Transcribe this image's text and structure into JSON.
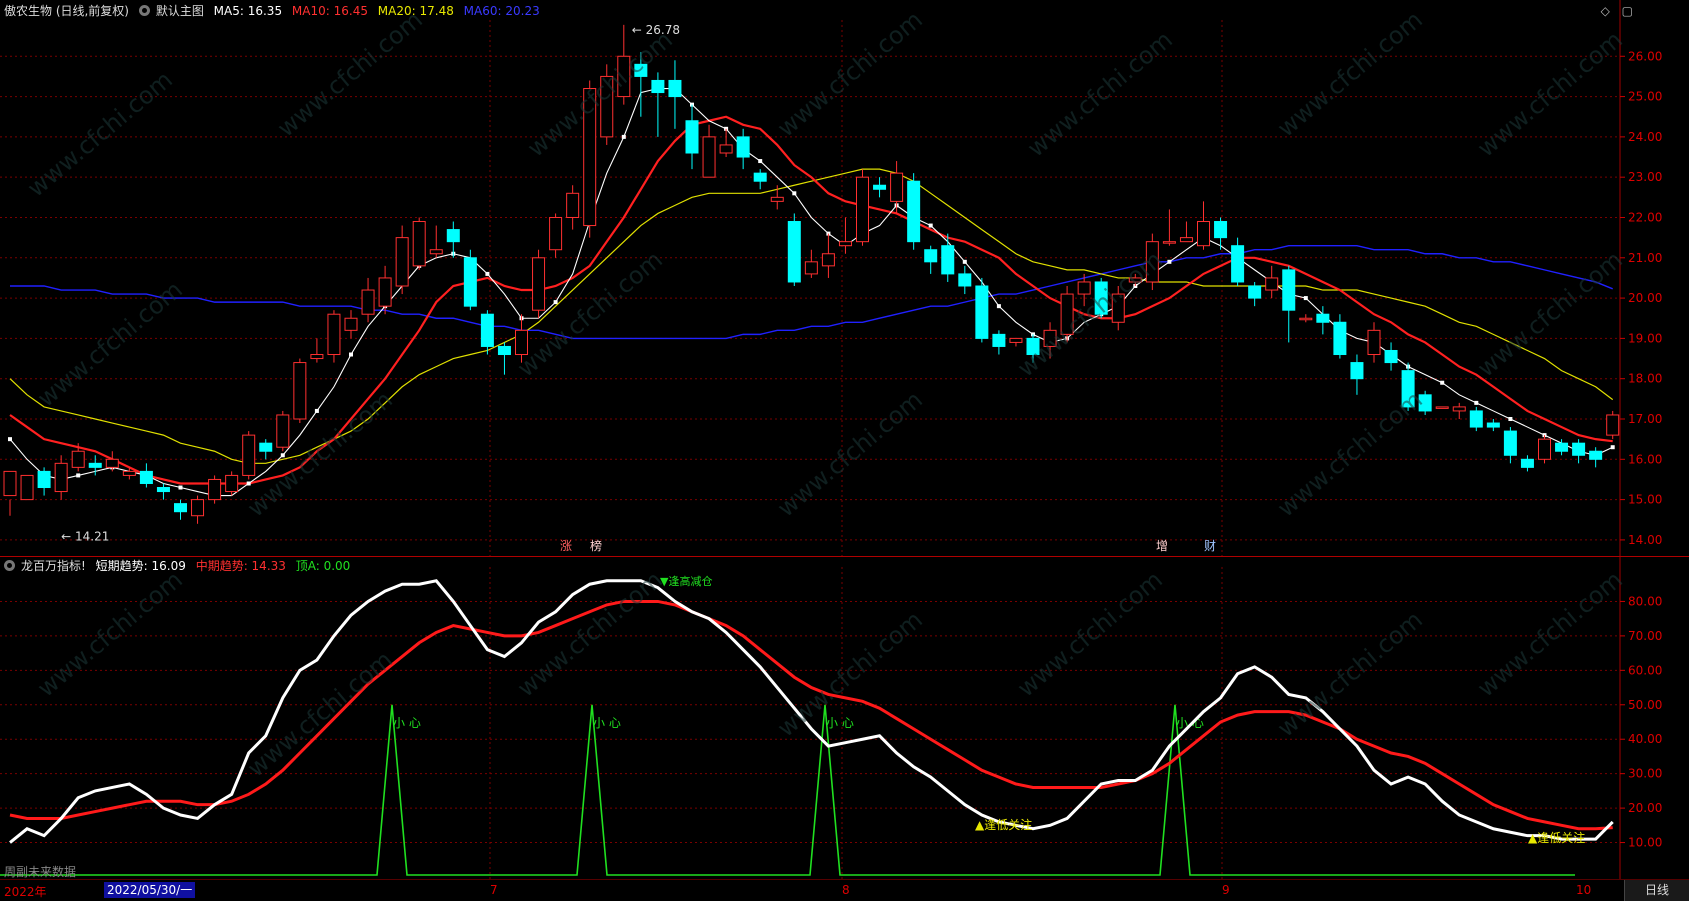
{
  "main_header": {
    "stock": "傲农生物 (日线,前复权)",
    "template": "默认主图",
    "ma5": "MA5: 16.35",
    "ma10": "MA10: 16.45",
    "ma20": "MA20: 17.48",
    "ma60": "MA60: 20.23"
  },
  "indicator_header": {
    "name": "龙百万指标!",
    "short": "短期趋势: 16.09",
    "mid": "中期趋势: 14.33",
    "top": "顶A: 0.00"
  },
  "annotations": {
    "high": "26.78",
    "low": "14.21",
    "tags": [
      "涨",
      "榜",
      "增",
      "财"
    ],
    "caution": "小 心",
    "follow": "逢低关注",
    "wave": "▼逢高减仓",
    "future_data": "周副未来数据"
  },
  "icons": [
    "gear-icon",
    "diamond-icon",
    "window-icon"
  ],
  "bottom_axis": {
    "year": "2022年",
    "date": "2022/05/30/一",
    "months": [
      "7",
      "8",
      "9",
      "10"
    ],
    "period_button": "日线"
  },
  "watermark": "www.cfchi.com",
  "colors": {
    "up": "#ff3030",
    "down": "#00ffff",
    "ma5": "#ffffff",
    "ma10": "#ff2020",
    "ma20": "#e0e000",
    "ma60": "#2020ff",
    "signal": "#20e020",
    "grid": "#7a0000"
  },
  "chart_data": [
    {
      "type": "candlestick",
      "y_ticks": [
        "26.00",
        "25.00",
        "24.00",
        "23.00",
        "22.00",
        "21.00",
        "20.00",
        "19.00",
        "18.00",
        "17.00",
        "16.00",
        "15.00",
        "14.00"
      ],
      "ylim": [
        13.7,
        26.9
      ],
      "candles": [
        [
          15.1,
          15.7,
          15.0,
          14.6
        ],
        [
          15.0,
          15.6,
          15.1,
          15.5
        ],
        [
          15.7,
          15.3,
          15.8,
          15.1
        ],
        [
          15.2,
          15.9,
          15.0,
          16.1
        ],
        [
          15.8,
          16.2,
          15.7,
          16.4
        ],
        [
          15.9,
          15.8,
          16.1,
          15.6
        ],
        [
          15.8,
          16.0,
          15.7,
          16.2
        ],
        [
          15.6,
          15.7,
          15.8,
          15.5
        ],
        [
          15.7,
          15.4,
          15.9,
          15.3
        ],
        [
          15.3,
          15.2,
          15.4,
          15.0
        ],
        [
          14.9,
          14.7,
          15.0,
          14.5
        ],
        [
          14.6,
          15.0,
          14.4,
          15.1
        ],
        [
          15.0,
          15.5,
          14.9,
          15.6
        ],
        [
          15.2,
          15.6,
          15.1,
          15.7
        ],
        [
          15.6,
          16.6,
          15.5,
          16.7
        ],
        [
          16.4,
          16.2,
          16.5,
          16.0
        ],
        [
          16.3,
          17.1,
          16.2,
          17.2
        ],
        [
          17.0,
          18.4,
          16.9,
          18.5
        ],
        [
          18.5,
          18.6,
          18.4,
          19.0
        ],
        [
          18.6,
          19.6,
          18.4,
          19.7
        ],
        [
          19.2,
          19.5,
          19.0,
          19.7
        ],
        [
          19.6,
          20.2,
          19.4,
          20.5
        ],
        [
          19.8,
          20.5,
          19.6,
          20.8
        ],
        [
          20.3,
          21.5,
          20.1,
          21.8
        ],
        [
          20.8,
          21.9,
          20.7,
          22.0
        ],
        [
          21.1,
          21.2,
          21.0,
          21.8
        ],
        [
          21.7,
          21.4,
          21.9,
          21.0
        ],
        [
          21.0,
          19.8,
          21.2,
          19.7
        ],
        [
          19.6,
          18.8,
          19.7,
          18.6
        ],
        [
          18.8,
          18.6,
          18.9,
          18.1
        ],
        [
          18.6,
          19.2,
          18.4,
          19.6
        ],
        [
          19.7,
          21.0,
          19.5,
          21.2
        ],
        [
          21.2,
          22.0,
          21.0,
          22.1
        ],
        [
          22.0,
          22.6,
          21.7,
          22.8
        ],
        [
          21.8,
          25.2,
          21.5,
          25.4
        ],
        [
          24.0,
          25.5,
          23.8,
          25.8
        ],
        [
          25.0,
          26.0,
          24.8,
          26.78
        ],
        [
          25.8,
          25.5,
          26.1,
          24.5
        ],
        [
          25.4,
          25.1,
          25.6,
          24.0
        ],
        [
          25.4,
          25.0,
          25.9,
          24.2
        ],
        [
          24.4,
          23.6,
          24.8,
          23.2
        ],
        [
          23.0,
          24.0,
          23.0,
          24.3
        ],
        [
          23.6,
          23.8,
          23.5,
          24.2
        ],
        [
          24.0,
          23.5,
          24.2,
          23.2
        ],
        [
          23.1,
          22.9,
          23.2,
          22.7
        ],
        [
          22.4,
          22.5,
          22.2,
          22.8
        ],
        [
          21.9,
          20.4,
          22.1,
          20.3
        ],
        [
          20.6,
          20.9,
          20.5,
          21.2
        ],
        [
          20.8,
          21.1,
          20.5,
          21.6
        ],
        [
          21.3,
          21.4,
          21.1,
          22.0
        ],
        [
          21.4,
          23.0,
          21.3,
          23.2
        ],
        [
          22.8,
          22.7,
          23.0,
          22.5
        ],
        [
          22.4,
          23.1,
          22.1,
          23.4
        ],
        [
          22.9,
          21.4,
          23.1,
          21.2
        ],
        [
          21.2,
          20.9,
          21.3,
          20.6
        ],
        [
          21.3,
          20.6,
          21.6,
          20.4
        ],
        [
          20.6,
          20.3,
          20.8,
          20.1
        ],
        [
          20.3,
          19.0,
          20.5,
          18.9
        ],
        [
          19.1,
          18.8,
          19.2,
          18.6
        ],
        [
          18.9,
          19.0,
          18.9,
          18.8
        ],
        [
          19.0,
          18.6,
          19.1,
          18.4
        ],
        [
          18.8,
          19.2,
          18.5,
          19.4
        ],
        [
          19.1,
          20.1,
          18.9,
          20.3
        ],
        [
          20.1,
          20.4,
          19.8,
          20.6
        ],
        [
          20.4,
          19.6,
          20.5,
          19.5
        ],
        [
          19.4,
          20.1,
          19.2,
          20.3
        ],
        [
          20.4,
          20.5,
          20.3,
          20.6
        ],
        [
          20.4,
          21.4,
          20.2,
          21.6
        ],
        [
          21.4,
          21.4,
          21.3,
          22.2
        ],
        [
          21.4,
          21.5,
          21.4,
          21.9
        ],
        [
          21.3,
          21.9,
          21.2,
          22.4
        ],
        [
          21.9,
          21.5,
          22.0,
          21.2
        ],
        [
          21.3,
          20.4,
          21.5,
          20.3
        ],
        [
          20.3,
          20.0,
          20.4,
          19.8
        ],
        [
          20.2,
          20.5,
          20.0,
          20.8
        ],
        [
          20.7,
          19.7,
          20.8,
          18.9
        ],
        [
          19.5,
          19.5,
          19.6,
          19.4
        ],
        [
          19.6,
          19.4,
          19.8,
          19.1
        ],
        [
          19.4,
          18.6,
          19.6,
          18.5
        ],
        [
          18.4,
          18.0,
          18.6,
          17.6
        ],
        [
          18.6,
          19.2,
          18.4,
          19.4
        ],
        [
          18.7,
          18.4,
          18.9,
          18.2
        ],
        [
          18.2,
          17.3,
          18.4,
          17.2
        ],
        [
          17.6,
          17.2,
          17.7,
          17.1
        ],
        [
          17.3,
          17.3,
          17.3,
          17.3
        ],
        [
          17.2,
          17.3,
          17.0,
          17.4
        ],
        [
          17.2,
          16.8,
          17.3,
          16.7
        ],
        [
          16.9,
          16.8,
          17.0,
          16.7
        ],
        [
          16.7,
          16.1,
          16.8,
          15.9
        ],
        [
          16.0,
          15.8,
          16.1,
          15.7
        ],
        [
          16.0,
          16.5,
          15.9,
          16.6
        ],
        [
          16.4,
          16.2,
          16.5,
          16.1
        ],
        [
          16.4,
          16.1,
          16.5,
          15.9
        ],
        [
          16.2,
          16.0,
          16.3,
          15.8
        ],
        [
          16.6,
          17.1,
          16.5,
          17.2
        ]
      ],
      "ma5": [
        16.5,
        16.0,
        15.6,
        15.5,
        15.6,
        15.7,
        15.8,
        15.7,
        15.6,
        15.4,
        15.3,
        15.2,
        15.1,
        15.1,
        15.4,
        15.7,
        16.1,
        16.6,
        17.2,
        17.8,
        18.6,
        19.3,
        19.8,
        20.3,
        20.8,
        21.0,
        21.1,
        21.0,
        20.6,
        20.1,
        19.5,
        19.5,
        19.9,
        20.6,
        21.9,
        23.1,
        24.0,
        25.1,
        25.2,
        25.2,
        24.8,
        24.4,
        24.2,
        23.7,
        23.4,
        23.0,
        22.6,
        22.0,
        21.6,
        21.3,
        21.6,
        21.8,
        22.3,
        22.0,
        21.8,
        21.4,
        20.9,
        20.4,
        19.8,
        19.4,
        19.1,
        18.9,
        19.0,
        19.4,
        19.6,
        19.8,
        20.3,
        20.6,
        20.9,
        21.2,
        21.5,
        21.3,
        21.0,
        20.7,
        20.4,
        20.1,
        20.0,
        19.6,
        19.2,
        19.0,
        18.9,
        18.6,
        18.3,
        18.1,
        17.9,
        17.6,
        17.4,
        17.2,
        17.0,
        16.8,
        16.6,
        16.4,
        16.2,
        16.1,
        16.3
      ],
      "ma10": [
        17.1,
        16.8,
        16.5,
        16.4,
        16.3,
        16.2,
        16.0,
        15.8,
        15.6,
        15.5,
        15.4,
        15.4,
        15.4,
        15.4,
        15.4,
        15.5,
        15.6,
        15.8,
        16.2,
        16.5,
        17.0,
        17.5,
        18.0,
        18.6,
        19.2,
        19.9,
        20.3,
        20.4,
        20.5,
        20.3,
        20.2,
        20.2,
        20.3,
        20.5,
        20.8,
        21.4,
        22.0,
        22.7,
        23.4,
        23.9,
        24.3,
        24.4,
        24.5,
        24.3,
        24.2,
        23.8,
        23.3,
        23.0,
        22.6,
        22.4,
        22.3,
        22.2,
        22.1,
        21.9,
        21.7,
        21.5,
        21.4,
        21.2,
        21.0,
        20.6,
        20.3,
        20.0,
        19.8,
        19.6,
        19.5,
        19.5,
        19.6,
        19.8,
        20.0,
        20.3,
        20.6,
        20.8,
        21.0,
        21.0,
        20.9,
        20.8,
        20.6,
        20.4,
        20.2,
        19.9,
        19.6,
        19.4,
        19.1,
        18.9,
        18.6,
        18.3,
        18.1,
        17.8,
        17.5,
        17.2,
        17.0,
        16.8,
        16.6,
        16.5,
        16.45
      ],
      "ma20": [
        18.0,
        17.6,
        17.3,
        17.2,
        17.1,
        17.0,
        16.9,
        16.8,
        16.7,
        16.6,
        16.4,
        16.3,
        16.2,
        16.0,
        15.9,
        15.9,
        16.0,
        16.1,
        16.3,
        16.5,
        16.7,
        17.0,
        17.4,
        17.8,
        18.1,
        18.3,
        18.5,
        18.6,
        18.7,
        18.9,
        19.1,
        19.4,
        19.8,
        20.2,
        20.6,
        21.0,
        21.4,
        21.8,
        22.1,
        22.3,
        22.5,
        22.6,
        22.6,
        22.6,
        22.6,
        22.7,
        22.8,
        22.9,
        23.0,
        23.1,
        23.2,
        23.2,
        23.1,
        22.9,
        22.6,
        22.3,
        22.0,
        21.7,
        21.4,
        21.1,
        20.9,
        20.8,
        20.7,
        20.7,
        20.6,
        20.5,
        20.5,
        20.4,
        20.4,
        20.4,
        20.3,
        20.3,
        20.3,
        20.3,
        20.3,
        20.3,
        20.3,
        20.2,
        20.2,
        20.2,
        20.1,
        20.0,
        19.9,
        19.8,
        19.6,
        19.4,
        19.3,
        19.1,
        18.9,
        18.7,
        18.5,
        18.2,
        18.0,
        17.8,
        17.48
      ],
      "ma60": [
        20.3,
        20.3,
        20.3,
        20.2,
        20.2,
        20.2,
        20.1,
        20.1,
        20.1,
        20.0,
        20.0,
        20.0,
        19.9,
        19.9,
        19.9,
        19.9,
        19.9,
        19.8,
        19.8,
        19.8,
        19.8,
        19.7,
        19.7,
        19.6,
        19.6,
        19.5,
        19.5,
        19.4,
        19.3,
        19.3,
        19.2,
        19.2,
        19.1,
        19.0,
        19.0,
        19.0,
        19.0,
        19.0,
        19.0,
        19.0,
        19.0,
        19.0,
        19.0,
        19.1,
        19.1,
        19.2,
        19.2,
        19.3,
        19.3,
        19.4,
        19.4,
        19.5,
        19.6,
        19.7,
        19.8,
        19.8,
        19.9,
        20.0,
        20.1,
        20.1,
        20.2,
        20.3,
        20.4,
        20.5,
        20.6,
        20.7,
        20.8,
        20.9,
        20.9,
        21.0,
        21.0,
        21.1,
        21.1,
        21.2,
        21.2,
        21.3,
        21.3,
        21.3,
        21.3,
        21.3,
        21.2,
        21.2,
        21.2,
        21.1,
        21.1,
        21.0,
        21.0,
        20.9,
        20.9,
        20.8,
        20.7,
        20.6,
        20.5,
        20.4,
        20.23
      ]
    },
    {
      "type": "line",
      "y_ticks": [
        "80.00",
        "70.00",
        "60.00",
        "50.00",
        "40.00",
        "30.00",
        "20.00",
        "10.00"
      ],
      "ylim": [
        0,
        90
      ],
      "short_trend": [
        10,
        14,
        12,
        17,
        23,
        25,
        26,
        27,
        24,
        20,
        18,
        17,
        21,
        24,
        36,
        41,
        52,
        60,
        63,
        70,
        76,
        80,
        83,
        85,
        85,
        86,
        80,
        73,
        66,
        64,
        68,
        74,
        77,
        82,
        85,
        86,
        86,
        86,
        84,
        80,
        77,
        75,
        71,
        66,
        61,
        55,
        49,
        43,
        38,
        39,
        40,
        41,
        36,
        32,
        29,
        25,
        21,
        18,
        16,
        15,
        14,
        15,
        17,
        22,
        27,
        28,
        28,
        31,
        38,
        43,
        48,
        52,
        59,
        61,
        58,
        53,
        52,
        48,
        43,
        38,
        31,
        27,
        29,
        27,
        22,
        18,
        16,
        14,
        13,
        12,
        12,
        11,
        11,
        11,
        16
      ],
      "mid_trend": [
        18,
        17,
        17,
        17,
        18,
        19,
        20,
        21,
        22,
        22,
        22,
        21,
        21,
        22,
        24,
        27,
        31,
        36,
        41,
        46,
        51,
        56,
        60,
        64,
        68,
        71,
        73,
        72,
        71,
        70,
        70,
        71,
        73,
        75,
        77,
        79,
        80,
        80,
        80,
        79,
        77,
        75,
        73,
        70,
        66,
        62,
        58,
        55,
        53,
        52,
        51,
        49,
        46,
        43,
        40,
        37,
        34,
        31,
        29,
        27,
        26,
        26,
        26,
        26,
        26,
        27,
        28,
        30,
        33,
        37,
        41,
        45,
        47,
        48,
        48,
        48,
        47,
        45,
        43,
        40,
        38,
        36,
        35,
        33,
        30,
        27,
        24,
        21,
        19,
        17,
        16,
        15,
        14,
        14,
        14.33
      ],
      "signal": [
        [
          36,
          50
        ],
        [
          55,
          50
        ],
        [
          77,
          50
        ],
        [
          110,
          50
        ]
      ]
    }
  ]
}
